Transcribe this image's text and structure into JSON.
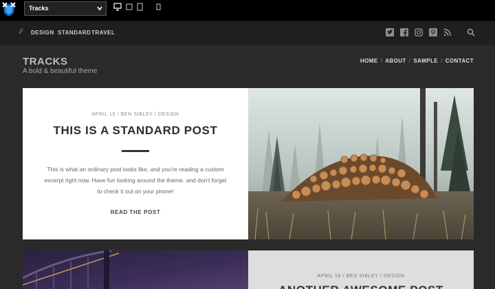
{
  "switcher": {
    "theme_select": "Tracks",
    "devices": [
      "desktop-icon",
      "tablet-landscape-icon",
      "tablet-icon",
      "phone-icon"
    ]
  },
  "nav": {
    "slash": "//",
    "categories": [
      "DESIGN",
      "STANDARD",
      "TRAVEL"
    ],
    "social": [
      "twitter-icon",
      "facebook-icon",
      "instagram-icon",
      "pinterest-icon",
      "rss-icon"
    ],
    "search_icon": "search-icon"
  },
  "header": {
    "title": "TRACKS",
    "tagline": "A bold & beautiful theme",
    "menu": [
      "HOME",
      "ABOUT",
      "SAMPLE",
      "CONTACT"
    ],
    "menu_separator": "/"
  },
  "posts": [
    {
      "meta": "APRIL 19 / BEN SIBLEY / DESIGN",
      "title": "THIS IS A STANDARD POST",
      "excerpt": "This is what an ordinary post looks like, and you're reading a custom excerpt right now. Have fun looking around the theme, and don't forget to check it out on your phone!",
      "read_more": "READ THE POST",
      "image": "misty-forest-log-pile"
    },
    {
      "meta": "APRIL 18 / BEN SIBLEY / DESIGN",
      "title": "ANOTHER AWESOME POST",
      "image": "bridge-at-night"
    }
  ],
  "colors": {
    "page_bg": "#2a2a2a",
    "nav_bg": "#1f1f1f",
    "switcher_bg": "#000000",
    "card_bg": "#ffffff",
    "card2_bg": "#dedede"
  }
}
